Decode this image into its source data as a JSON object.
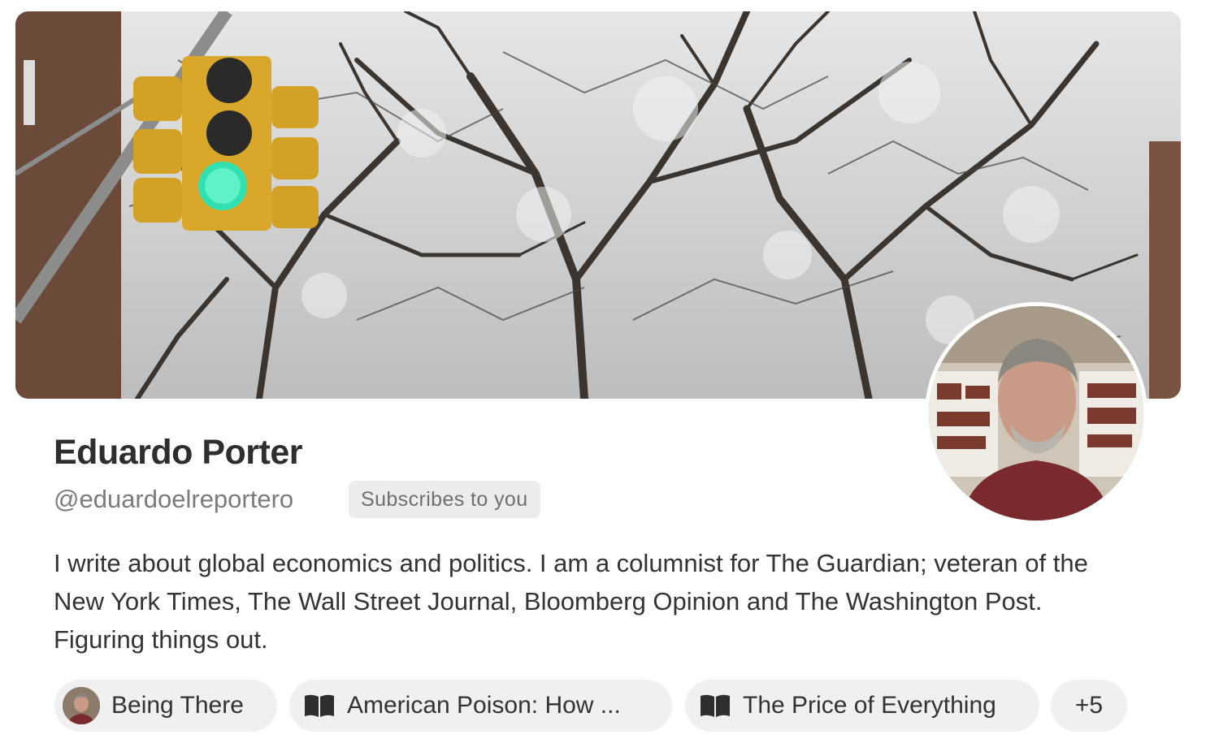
{
  "profile": {
    "name": "Eduardo Porter",
    "handle": "@eduardoelreportero",
    "badge": "Subscribes to you",
    "bio": "I write about global economics and politics. I am a columnist for The Guardian; veteran of the New York Times, The Wall Street Journal, Bloomberg Opinion and The Washington Post. Figuring things out."
  },
  "publications": [
    {
      "label": "Being There",
      "icon": "avatar"
    },
    {
      "label": "American Poison: How ...",
      "icon": "book-icon"
    },
    {
      "label": "The Price of Everything",
      "icon": "book-icon"
    }
  ],
  "more_count": "+5",
  "colors": {
    "traffic_light": "#d9a82a",
    "green_signal": "#2fe0b0",
    "badge_bg": "#ececec",
    "chip_bg": "#f0f0f0"
  }
}
